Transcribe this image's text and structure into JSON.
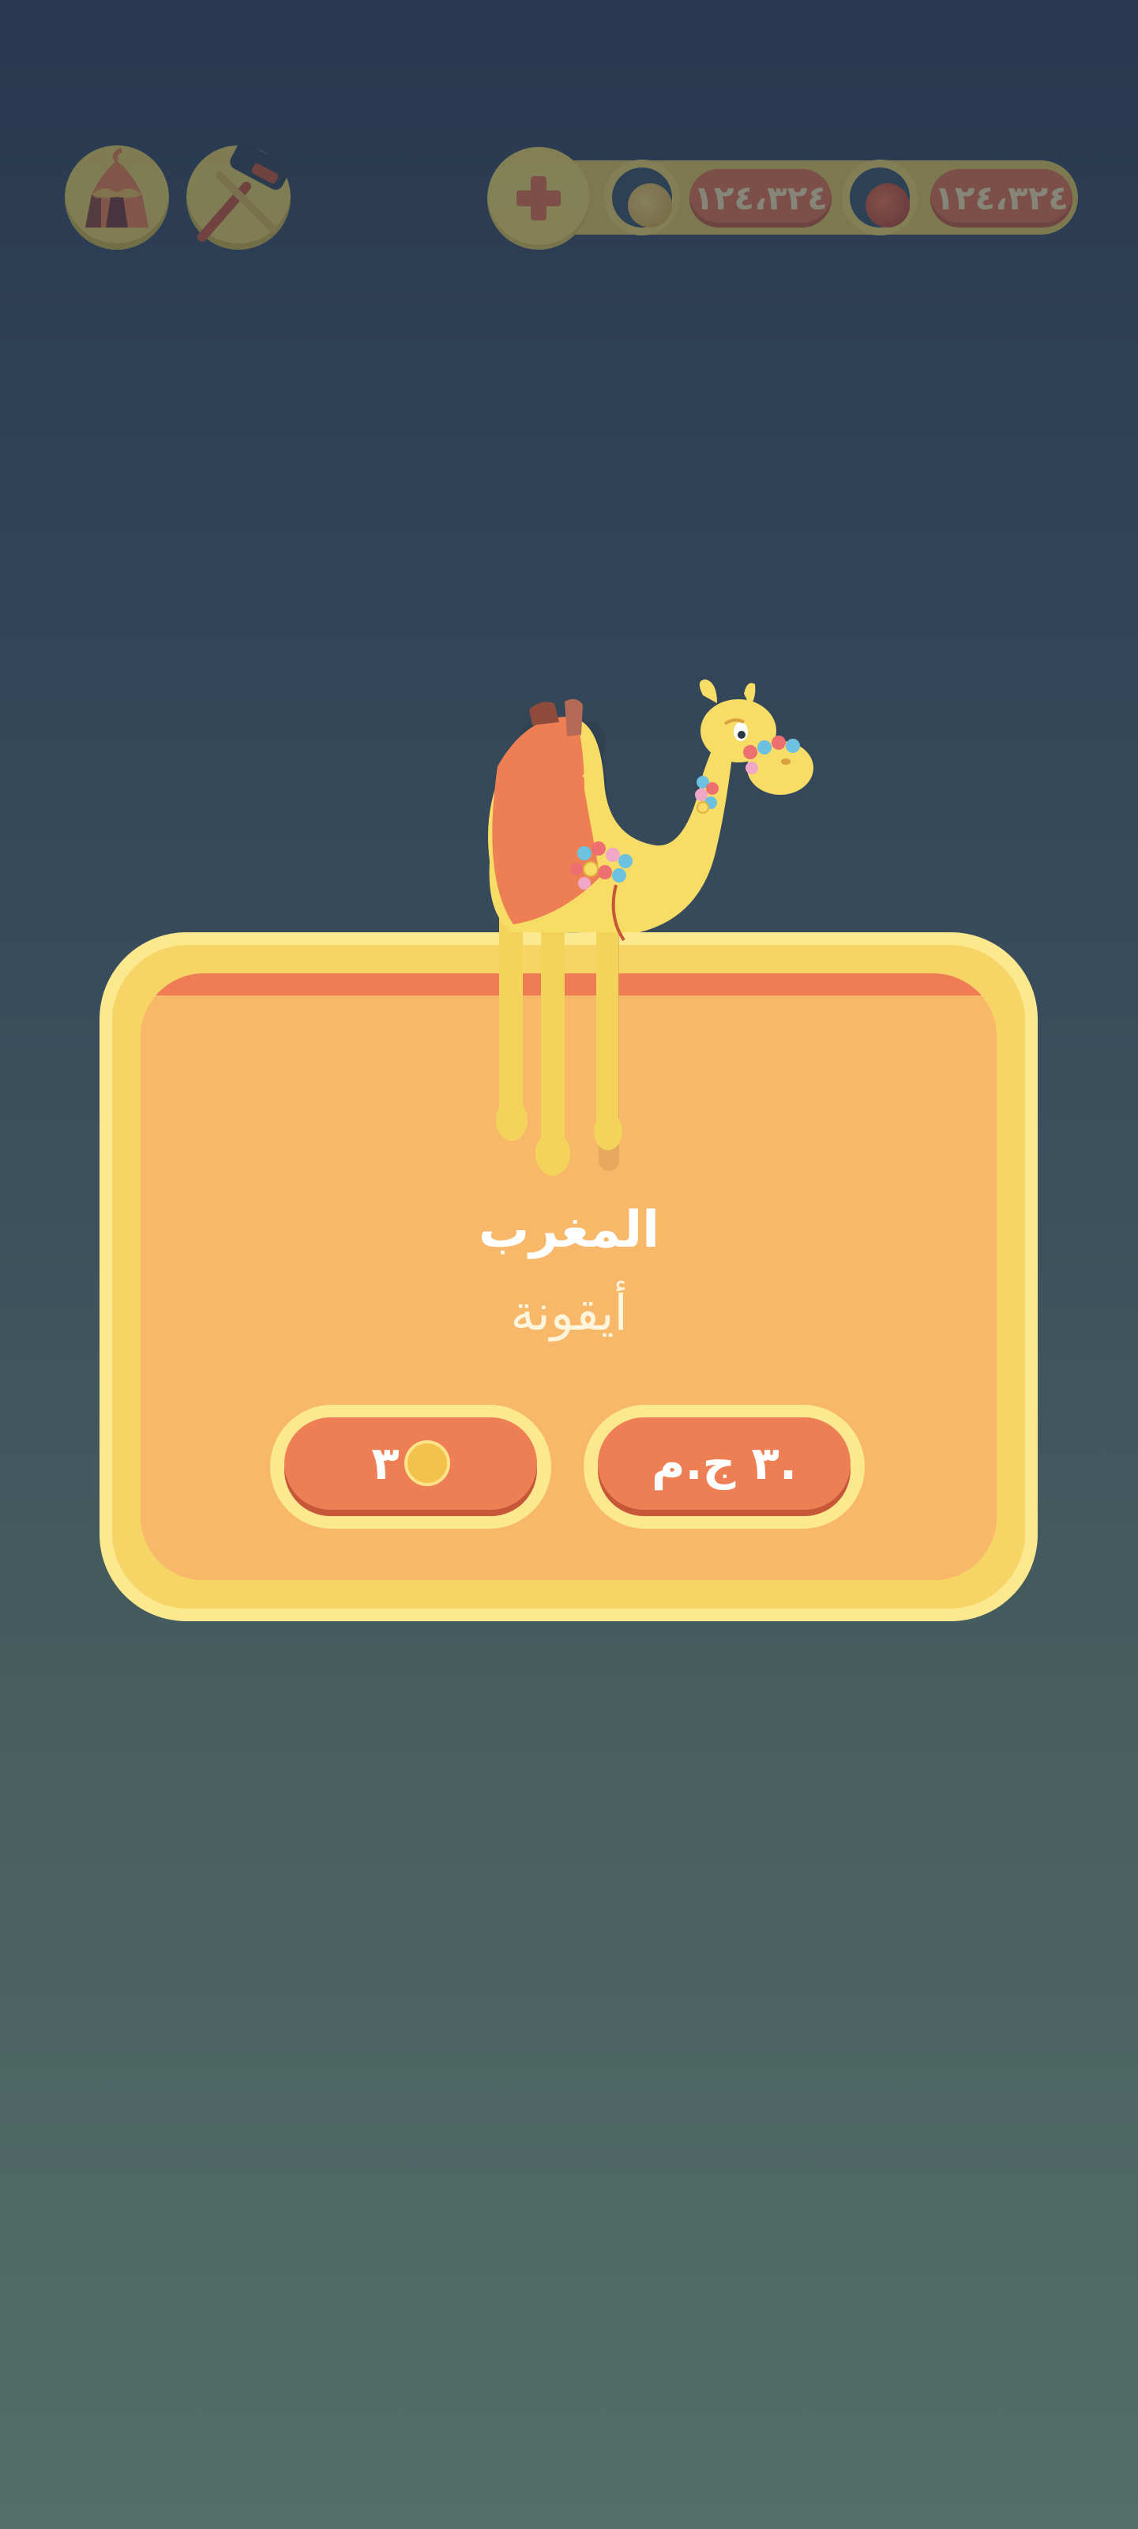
{
  "top_bar": {
    "tools": [
      {
        "name": "tent-icon"
      },
      {
        "name": "hammer-icon"
      }
    ],
    "add_button_icon": "plus-icon",
    "resources": [
      {
        "icon": "gold-coin-icon",
        "value": "١٢٤،٣٢٤"
      },
      {
        "icon": "red-gem-icon",
        "value": "١٢٤،٣٢٤"
      }
    ]
  },
  "item_card": {
    "title": "المغرب",
    "subtitle": "أيقونة",
    "price_money": "٣ ج.م.",
    "price_coins": "٣"
  },
  "colors": {
    "accent": "#ee7f55",
    "card_fill": "#f7b86a",
    "card_border": "#fce88f",
    "coin": "#f3c24a"
  }
}
